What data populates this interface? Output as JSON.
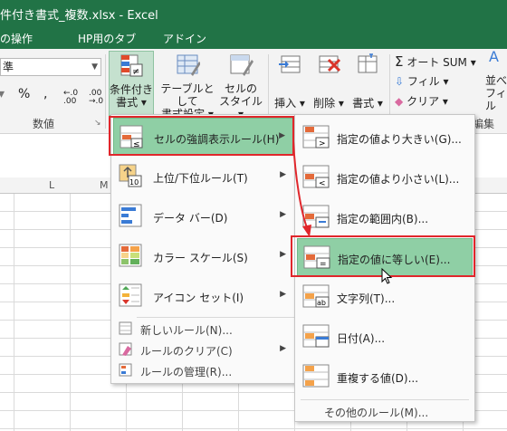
{
  "window": {
    "title": "件付き書式_複数.xlsx - Excel"
  },
  "ribbon_tabs": [
    "の操作",
    "HP用のタブ",
    "アドイン"
  ],
  "number_group": {
    "format_value": "準",
    "percent": "%",
    "comma": ",",
    "inc_decimal": "←.0 .00",
    "dec_decimal": ".00 →.0",
    "label": "数値"
  },
  "buttons": {
    "conditional_format": [
      "条件付き",
      "書式 ▾"
    ],
    "format_as_table": [
      "テーブルとして",
      "書式設定 ▾"
    ],
    "cell_styles": [
      "セルの",
      "スタイル ▾"
    ],
    "insert": "挿入 ▾",
    "delete": "削除 ▾",
    "format": "書式 ▾",
    "autosum": "オート SUM ▾",
    "fill": "フィル ▾",
    "clear": "クリア ▾",
    "sort": [
      "並べ",
      "フィル"
    ],
    "edit_group_label": "編集"
  },
  "columns": [
    "L",
    "M"
  ],
  "main_menu": {
    "items": [
      {
        "label": "セルの強調表示ルール(H)"
      },
      {
        "label": "上位/下位ルール(T)"
      },
      {
        "label": "データ バー(D)"
      },
      {
        "label": "カラー スケール(S)"
      },
      {
        "label": "アイコン セット(I)"
      }
    ],
    "small_items": [
      {
        "label": "新しいルール(N)..."
      },
      {
        "label": "ルールのクリア(C)"
      },
      {
        "label": "ルールの管理(R)..."
      }
    ]
  },
  "sub_menu": {
    "items": [
      {
        "label": "指定の値より大きい(G)..."
      },
      {
        "label": "指定の値より小さい(L)..."
      },
      {
        "label": "指定の範囲内(B)..."
      },
      {
        "label": "指定の値に等しい(E)..."
      },
      {
        "label": "文字列(T)..."
      },
      {
        "label": "日付(A)..."
      },
      {
        "label": "重複する値(D)..."
      }
    ],
    "other_rules": "その他のルール(M)..."
  },
  "colors": {
    "excel_green": "#217346",
    "highlight": "#8fcfa5",
    "annotation_red": "#e0262b"
  }
}
